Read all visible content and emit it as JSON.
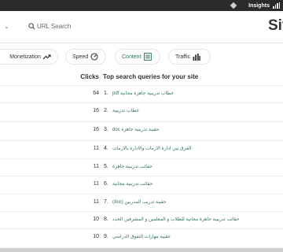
{
  "topbar": {
    "insights_label": "Insights"
  },
  "header": {
    "url_search_placeholder": "URL Search",
    "site_title": "Sit"
  },
  "tabs": [
    {
      "label": "Monetization"
    },
    {
      "label": "Speed"
    },
    {
      "label": "Content"
    },
    {
      "label": "Traffic"
    }
  ],
  "table": {
    "clicks_header": "Clicks",
    "queries_header": "Top search queries for your site",
    "rows": [
      {
        "clicks": "64",
        "num": "1.",
        "query": "pdf خطاب تدريبية جاهزة مجانية"
      },
      {
        "clicks": "16",
        "num": "2.",
        "query": "خطاب تدريبية"
      },
      {
        "clicks": "16",
        "num": "3.",
        "query": "doc حقيبة تدريبية جاهزة"
      },
      {
        "clicks": "11",
        "num": "4.",
        "query": "الفرق بين ادارة الازمات والادارة بالازمات"
      },
      {
        "clicks": "11",
        "num": "5.",
        "query": "حقائب تدريبية جاهزة"
      },
      {
        "clicks": "11",
        "num": "6.",
        "query": "حقائب تدريبية مجانية"
      },
      {
        "clicks": "11",
        "num": "7.",
        "query": "(doc) حقيبة تدريب المدربين"
      },
      {
        "clicks": "10",
        "num": "8.",
        "query": "حقائب تدريبية جاهزة مجانية للطلاب و المعلمين و المشرفين الجدد"
      },
      {
        "clicks": "10",
        "num": "9.",
        "query": "حقيبة مهارات التفوق الدراسي"
      }
    ]
  }
}
